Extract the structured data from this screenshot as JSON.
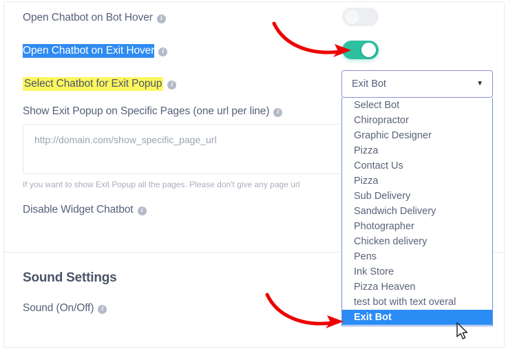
{
  "settings_rows": [
    {
      "label": "Open Chatbot on Bot Hover",
      "info": "i",
      "toggle": "off",
      "highlight": "none"
    },
    {
      "label": "Open Chatbot on Exit Hover",
      "info": "i",
      "toggle": "on",
      "highlight": "blue"
    },
    {
      "label": "Select Chatbot for Exit Popup",
      "info": "i",
      "toggle": "none",
      "highlight": "yellow"
    },
    {
      "label": "Show Exit Popup on Specific Pages (one url per line)",
      "info": "i",
      "toggle": "none",
      "highlight": "none"
    },
    {
      "label": "Disable Widget Chatbot",
      "info": "i",
      "toggle": "none",
      "highlight": "none"
    }
  ],
  "url_field": {
    "placeholder": "http://domain.com/show_specific_page_url",
    "value": "",
    "helper": "If you want to show Exit Popup all the pages. Please don't give any page url"
  },
  "sound_section": {
    "title": "Sound Settings",
    "row_label": "Sound (On/Off)",
    "info": "i"
  },
  "chatbot_select": {
    "selected_value": "Exit Bot",
    "caret": "▼",
    "options": [
      "Select Bot",
      "Chiropractor",
      "Graphic Designer",
      "Pizza",
      "Contact Us",
      "Pizza",
      "Sub Delivery",
      "Sandwich Delivery",
      "Photographer",
      "Chicken delivery",
      "Pens",
      "Ink Store",
      "Pizza Heaven",
      "test bot with text overal",
      "Exit Bot"
    ],
    "highlighted_index": 14
  },
  "colors": {
    "toggle_on": "#2dc1a0",
    "toggle_off": "#eceef2",
    "selection_blue": "#2e8bf2",
    "highlight_yellow": "#fcf75e",
    "dropdown_selected": "#2b8cf5",
    "select_border": "#8d8fe0",
    "arrow_red": "#ee0000",
    "text": "#56607a"
  },
  "annotations": [
    {
      "name": "arrow-to-exit-hover-toggle",
      "color": "#ee0000"
    },
    {
      "name": "arrow-to-selected-option",
      "color": "#ee0000"
    }
  ]
}
